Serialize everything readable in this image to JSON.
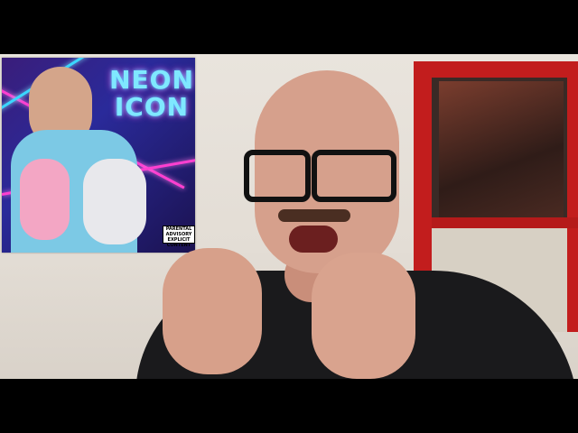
{
  "poster": {
    "title_line1": "NEON",
    "title_line2": "ICON",
    "advisory": "PARENTAL ADVISORY EXPLICIT CONTENT"
  }
}
